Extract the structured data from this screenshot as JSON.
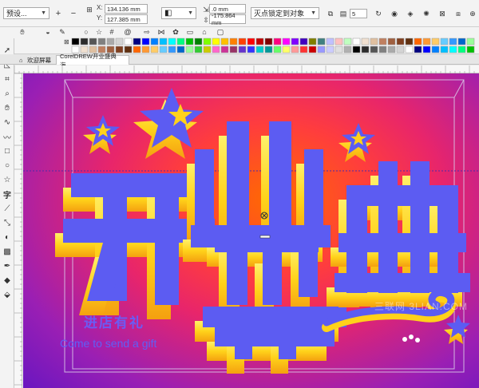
{
  "property_bar": {
    "preset_dropdown": "预设...",
    "x_label": "X:",
    "x_value": "134.136 mm",
    "y_label": "Y:",
    "y_value": "127.385 mm",
    "depth_value": ".0 mm",
    "depth2_value": "-175.864 mm",
    "vanishing_dropdown": "灭点锁定到对象",
    "steps_value": "5"
  },
  "tabs": {
    "welcome": "欢迎屏幕",
    "document": "CorelDREW开业盛典海..."
  },
  "canvas": {
    "chinese_subtitle": "进店有礼",
    "english_subtitle": "Come to send a gift",
    "watermark": "三联网 3LIAN.COM"
  },
  "icons": [
    "plus-icon",
    "minus-icon",
    "lock-icon",
    "rotate-icon",
    "arrow-icon",
    "dropdown-caret-icon",
    "pick-tool-icon",
    "shape-tool-icon",
    "crop-tool-icon",
    "zoom-tool-icon",
    "freehand-tool-icon",
    "artistic-media-icon",
    "rectangle-tool-icon",
    "ellipse-tool-icon",
    "polygon-tool-icon",
    "text-tool-icon",
    "parallel-dimension-icon",
    "connector-tool-icon",
    "blend-tool-icon",
    "transparency-tool-icon",
    "eyedropper-tool-icon",
    "fill-tool-icon",
    "home-icon"
  ],
  "colors": {
    "headline_blue": "#5c5cf2",
    "extrude_gold": "#ffd21a",
    "bg_orange": "#ff6a00",
    "bg_purple": "#7a18c2"
  }
}
